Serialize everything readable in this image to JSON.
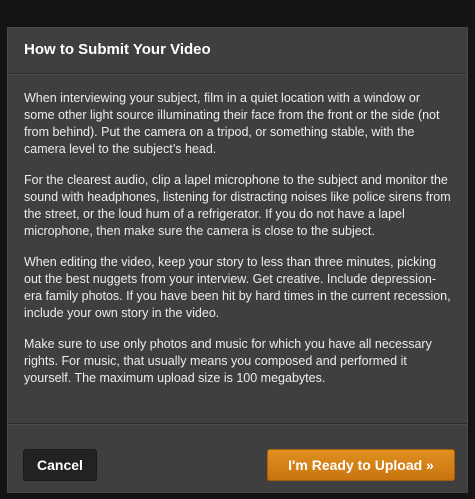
{
  "dialog": {
    "title": "How to Submit Your Video",
    "paragraphs": [
      "When interviewing your subject, film in a quiet location with a window or some other light source illuminating their face from the front or the side (not from behind).  Put the camera on a tripod, or something stable, with the camera level to the subject’s head.",
      "For the clearest audio, clip a lapel microphone to the subject and monitor the sound with headphones, listening for distracting noises like police sirens from the street, or the loud hum of a refrigerator.  If you do not have a lapel microphone, then make sure the camera is close to the subject.",
      "When editing the video, keep your story to less than three minutes, picking out the best nuggets from your interview.  Get creative.  Include depression-era family photos.  If you have been hit by hard times in the current recession, include your own story in the video.",
      "Make sure to use only photos and music for which you have all necessary rights.  For music, that usually means you composed and performed it yourself.  The maximum upload size is 100 megabytes."
    ],
    "cancel_label": "Cancel",
    "upload_label": "I'm Ready to Upload »"
  },
  "colors": {
    "page_background": "#141414",
    "dialog_background": "#3f3f3f",
    "upload_button": "#d9861a",
    "cancel_button": "#222222"
  }
}
